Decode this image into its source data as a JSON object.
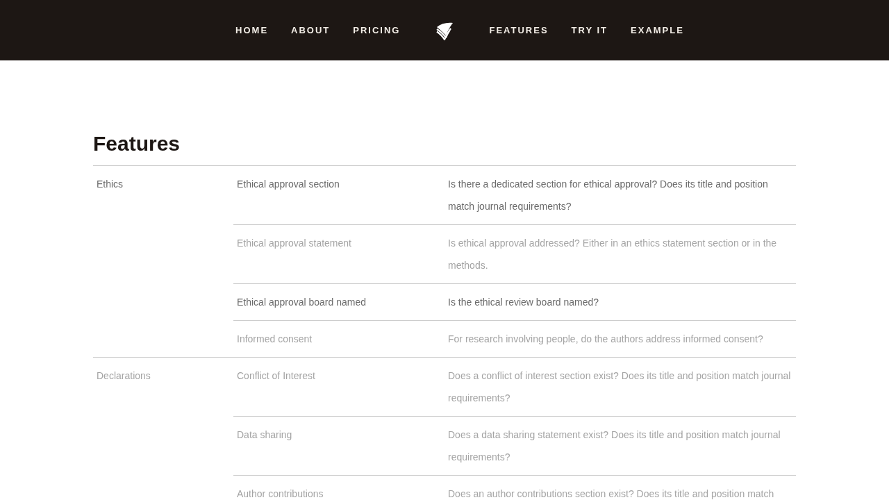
{
  "nav": {
    "items": [
      {
        "kind": "link",
        "label": "HOME"
      },
      {
        "kind": "link",
        "label": "ABOUT"
      },
      {
        "kind": "link",
        "label": "PRICING"
      },
      {
        "kind": "logo"
      },
      {
        "kind": "link",
        "label": "FEATURES"
      },
      {
        "kind": "link",
        "label": "TRY IT"
      },
      {
        "kind": "link",
        "label": "EXAMPLE"
      }
    ]
  },
  "page": {
    "title": "Features"
  },
  "table": {
    "groups": [
      {
        "category": "Ethics",
        "emphasized": true,
        "features": [
          {
            "name": "Ethical approval section",
            "description": "Is there a dedicated section for ethical approval? Does its title and position match journal requirements?",
            "emphasized": true
          },
          {
            "name": "Ethical approval statement",
            "description": "Is ethical approval addressed? Either in an ethics statement section or in the methods.",
            "emphasized": false
          },
          {
            "name": "Ethical approval board named",
            "description": "Is the ethical review board named?",
            "emphasized": true
          },
          {
            "name": "Informed consent",
            "description": "For research involving people, do the authors address informed consent?",
            "emphasized": false
          }
        ]
      },
      {
        "category": "Declarations",
        "emphasized": false,
        "features": [
          {
            "name": "Conflict of Interest",
            "description": "Does a conflict of interest section exist? Does its title and position match journal requirements?",
            "emphasized": false
          },
          {
            "name": "Data sharing",
            "description": "Does a data sharing statement exist? Does its title and position match journal requirements?",
            "emphasized": false
          },
          {
            "name": "Author contributions",
            "description": "Does an author contributions section exist? Does its title and position match",
            "emphasized": false
          }
        ]
      }
    ]
  }
}
